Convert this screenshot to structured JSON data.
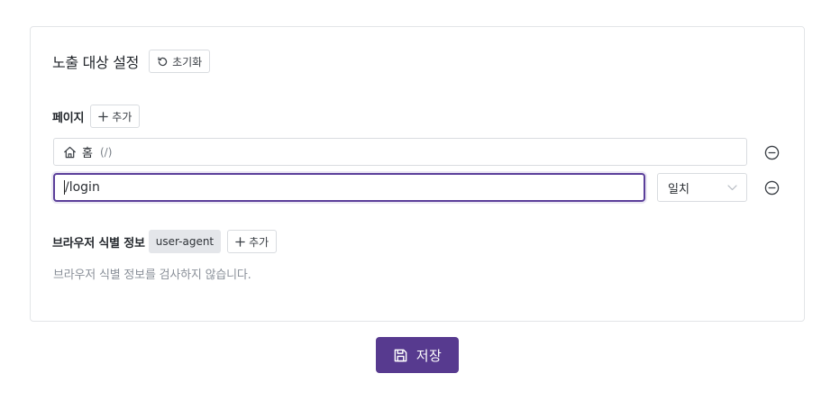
{
  "section": {
    "title": "노출 대상 설정",
    "reset_label": "초기화"
  },
  "pages": {
    "label": "페이지",
    "add_label": "추가",
    "entries": [
      {
        "name": "홈",
        "path": "(/)"
      }
    ],
    "input_value": "/login",
    "match_select": {
      "selected": "일치"
    }
  },
  "browser": {
    "label": "브라우저 식별 정보",
    "chip": "user-agent",
    "add_label": "추가",
    "help_text": "브라우저 식별 정보를 검사하지 않습니다."
  },
  "footer": {
    "save_label": "저장"
  },
  "colors": {
    "accent": "#573a8f",
    "focus_border": "#5b3f9a",
    "chip_bg": "#e4e6ea",
    "muted_text": "#8a9099"
  },
  "icons": [
    "reset-icon",
    "plus-icon",
    "home-icon",
    "chevron-down-icon",
    "remove-circle-icon",
    "save-icon"
  ]
}
